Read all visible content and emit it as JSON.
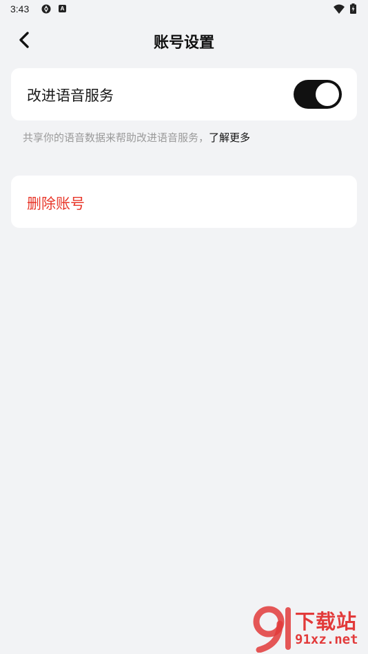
{
  "status_bar": {
    "time": "3:43",
    "icons": [
      "sync-icon",
      "a-icon",
      "wifi-icon",
      "battery-icon"
    ],
    "a_icon_letter": "A"
  },
  "header": {
    "title": "账号设置",
    "back_icon": "chevron-left-icon"
  },
  "voice_setting": {
    "label": "改进语音服务",
    "toggle_on": true,
    "hint": "共享你的语音数据来帮助改进语音服务，",
    "learn_more": "了解更多"
  },
  "account": {
    "delete_label": "删除账号"
  },
  "colors": {
    "background": "#f2f3f5",
    "card": "#ffffff",
    "danger": "#e8372a",
    "toggle_on": "#111111",
    "watermark": "#e23a3a"
  },
  "watermark": {
    "name": "下载站",
    "site": "91xz.net"
  }
}
